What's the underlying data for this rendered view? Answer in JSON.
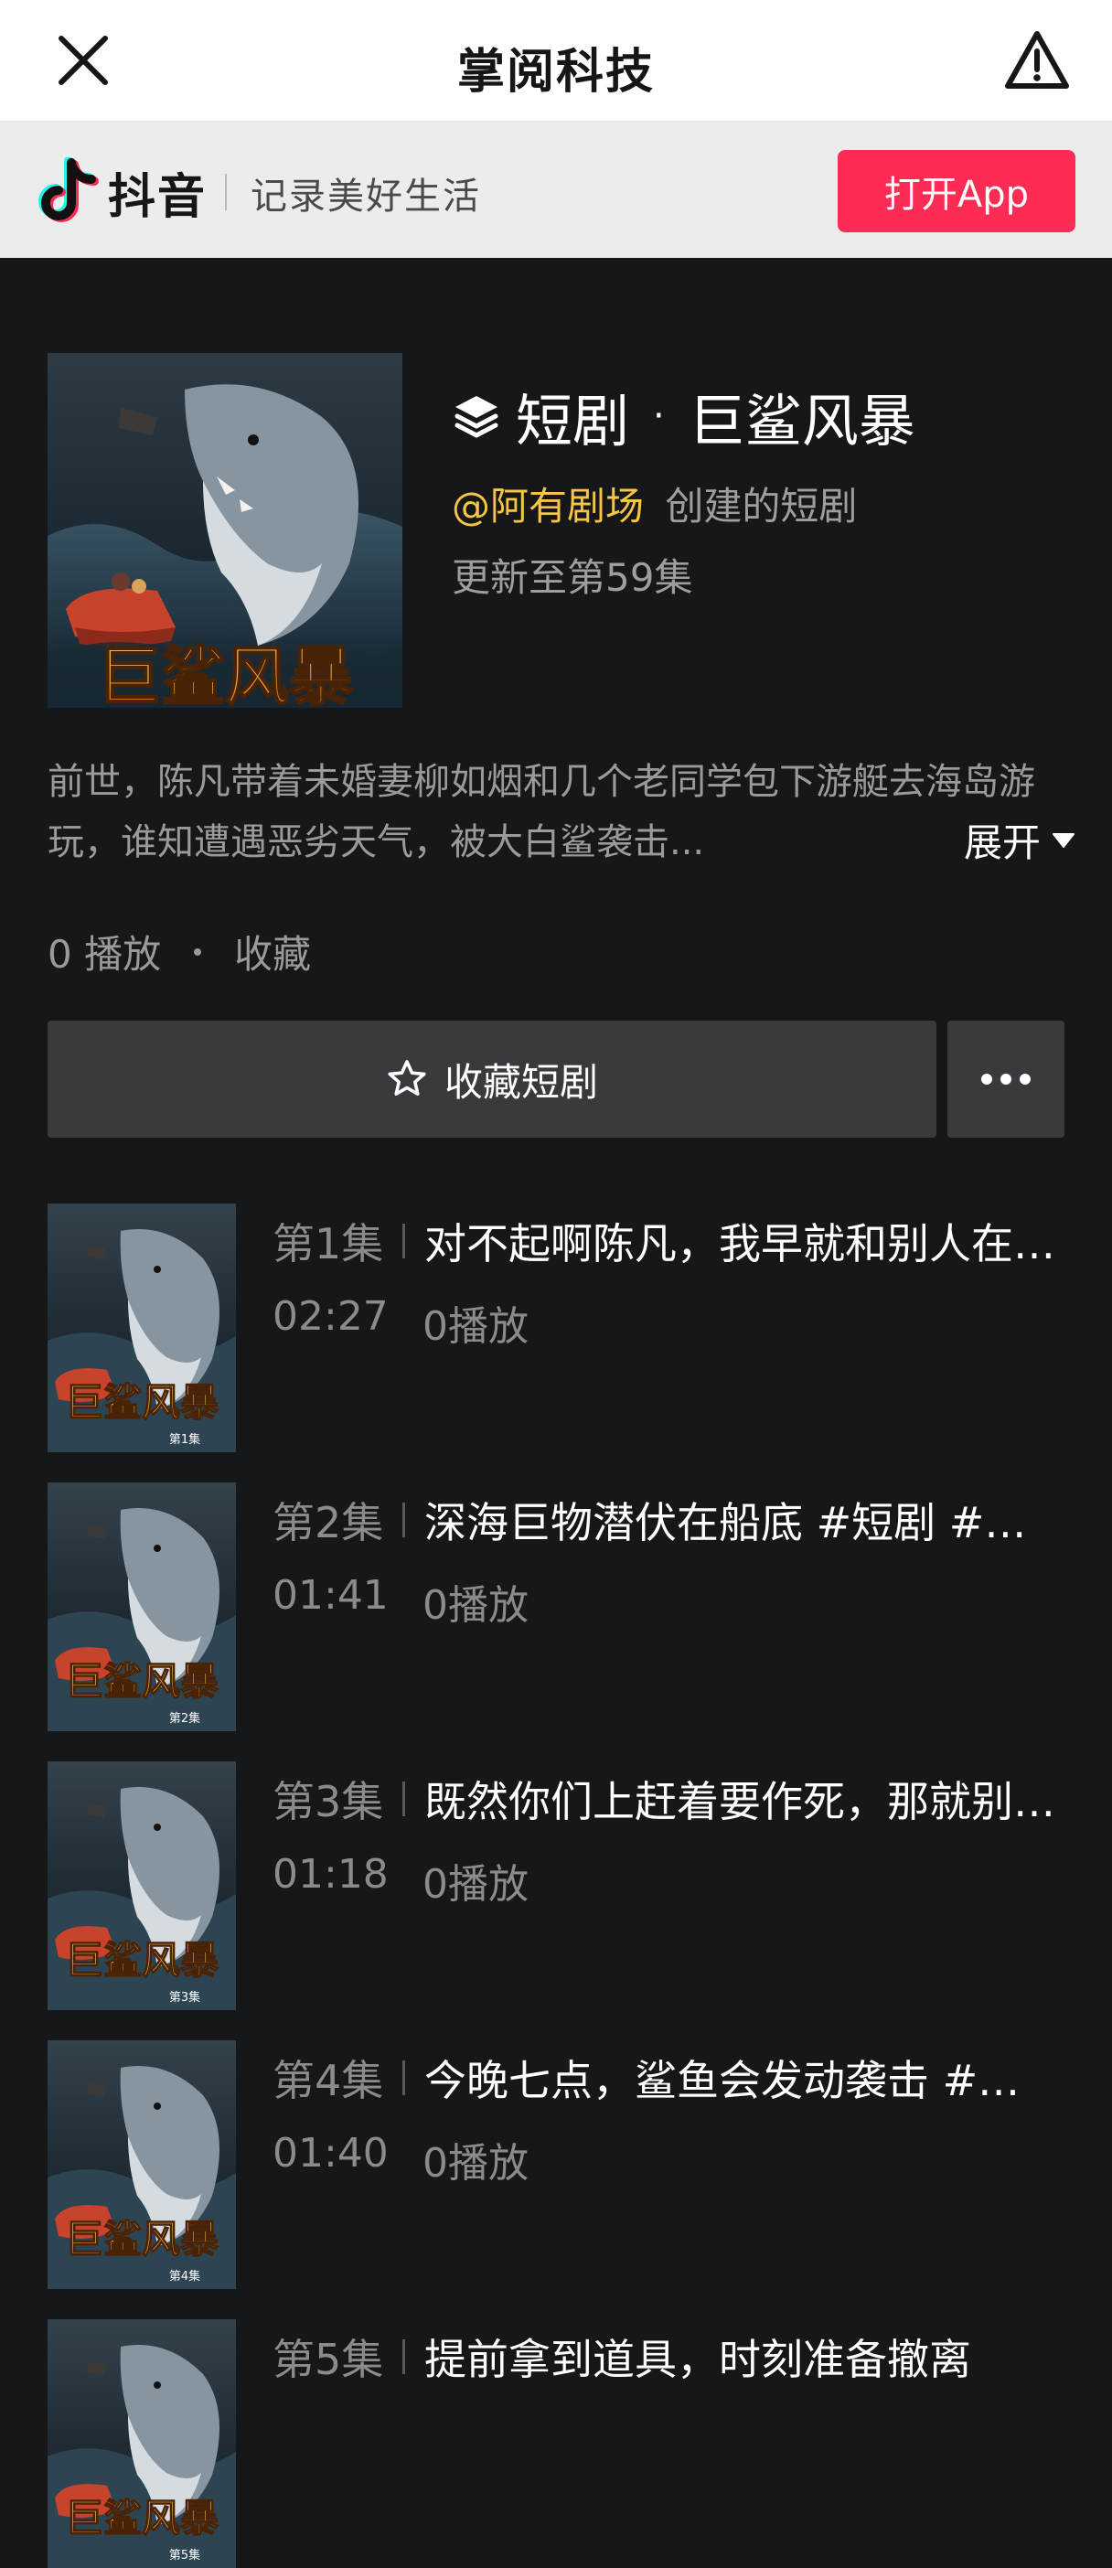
{
  "header": {
    "title": "掌阅科技"
  },
  "banner": {
    "logo_text": "抖音",
    "slogan": "记录美好生活",
    "open_app_label": "打开App"
  },
  "drama": {
    "cover_text": "巨鲨风暴",
    "category": "短剧",
    "name": "巨鲨风暴",
    "creator_handle": "@阿有剧场",
    "creator_suffix": "创建的短剧",
    "update_status": "更新至第59集",
    "synopsis": "前世，陈凡带着未婚妻柳如烟和几个老同学包下游艇去海岛游玩，谁知遭遇恶劣天气，被大白鲨袭击...",
    "expand_label": "展开",
    "plays": "0 播放",
    "favorites": "收藏",
    "favorite_button_label": "收藏短剧"
  },
  "episodes": [
    {
      "number": "第1集",
      "title": "对不起啊陈凡，我早就和别人在一起了",
      "duration": "02:27",
      "plays": "0播放",
      "thumb_label": "第1集"
    },
    {
      "number": "第2集",
      "title": "深海巨物潜伏在船底 #短剧 #巨鲨风暴",
      "duration": "01:41",
      "plays": "0播放",
      "thumb_label": "第2集"
    },
    {
      "number": "第3集",
      "title": "既然你们上赶着要作死，那就别怪我了",
      "duration": "01:18",
      "plays": "0播放",
      "thumb_label": "第3集"
    },
    {
      "number": "第4集",
      "title": "今晚七点，鲨鱼会发动袭击 #短剧",
      "duration": "01:40",
      "plays": "0播放",
      "thumb_label": "第4集"
    },
    {
      "number": "第5集",
      "title": "提前拿到道具，时刻准备撤离",
      "duration": "",
      "plays": "",
      "thumb_label": "第5集"
    }
  ],
  "icons": {
    "close": "close-icon",
    "report": "warning-icon",
    "layers": "layers-icon",
    "star": "star-icon",
    "more": "more-icon",
    "caret": "caret-down-icon"
  },
  "colors": {
    "accent_red": "#fe2c55",
    "creator_gold": "#f6c543",
    "background": "#161719",
    "button_bg": "#393a3e"
  }
}
